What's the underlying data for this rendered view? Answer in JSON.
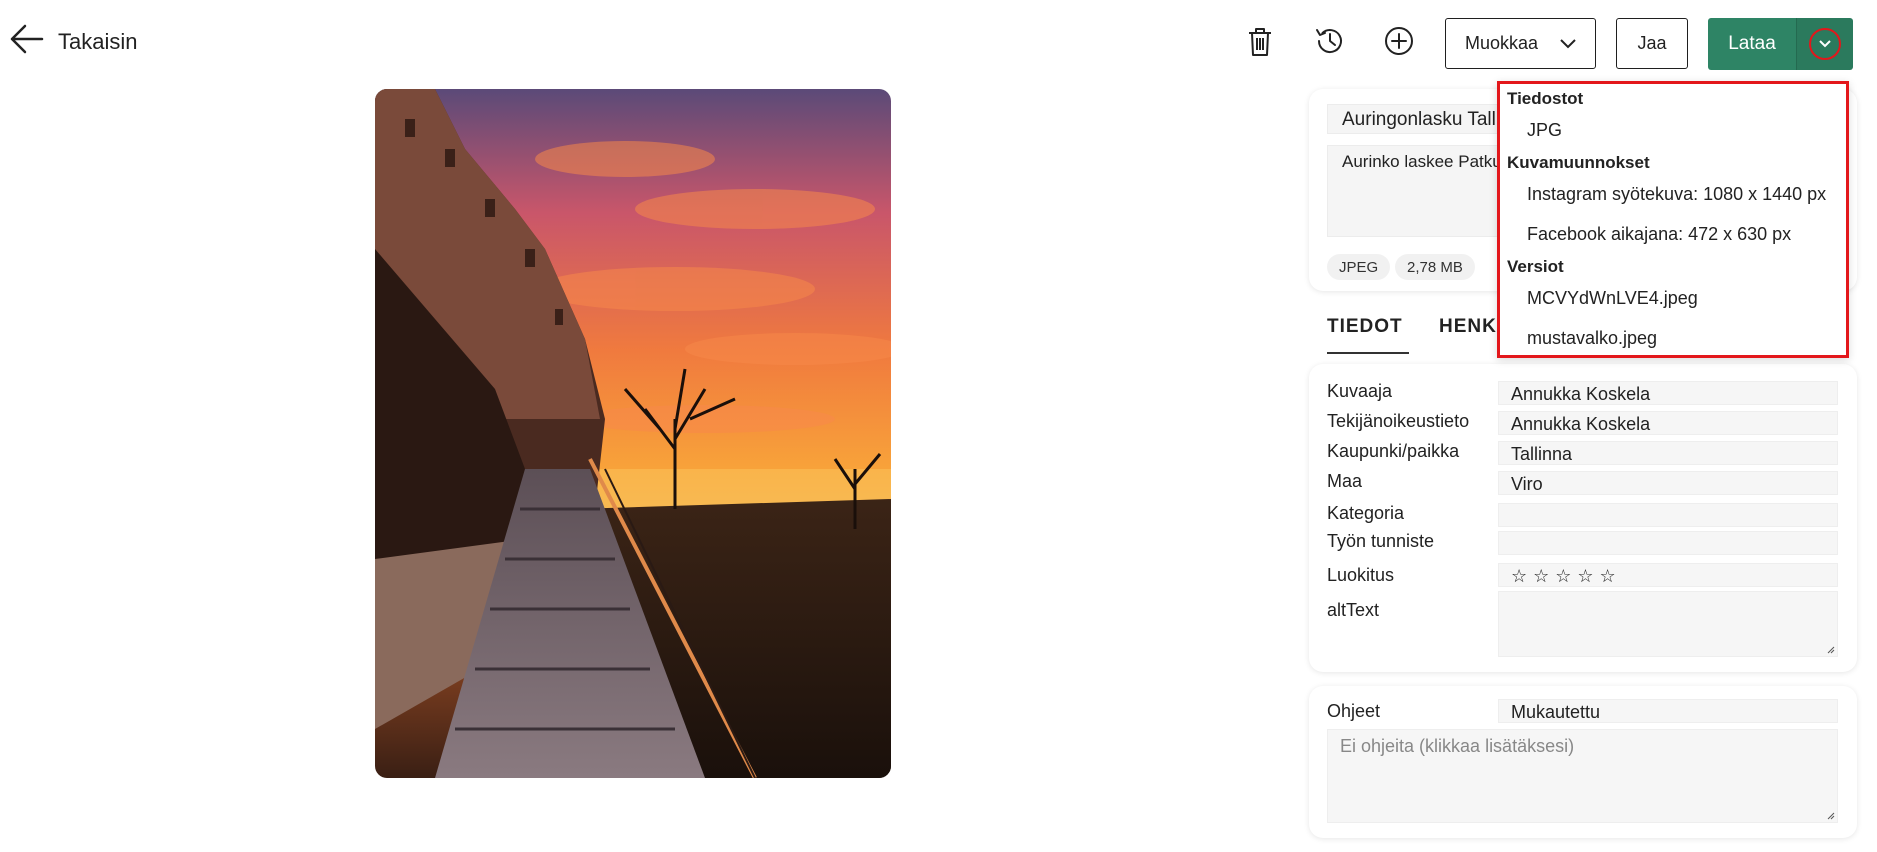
{
  "header": {
    "back_label": "Takaisin",
    "edit_label": "Muokkaa",
    "share_label": "Jaa",
    "download_label": "Lataa"
  },
  "asset": {
    "title": "Auringonlasku Tallinnassa",
    "description": "Aurinko laskee Patkuli",
    "chips": [
      "JPEG",
      "2,78 MB"
    ]
  },
  "tabs": [
    {
      "label": "TIEDOT"
    },
    {
      "label": "HENKILÖT"
    }
  ],
  "fields": [
    {
      "label": "Kuvaaja",
      "value": "Annukka Koskela"
    },
    {
      "label": "Tekijänoikeustieto",
      "value": "Annukka Koskela"
    },
    {
      "label": "Kaupunki/paikka",
      "value": "Tallinna"
    },
    {
      "label": "Maa",
      "value": "Viro"
    },
    {
      "label": "Kategoria",
      "value": ""
    },
    {
      "label": "Työn tunniste",
      "value": ""
    },
    {
      "label": "Luokitus",
      "value": "☆☆☆☆☆"
    },
    {
      "label": "altText",
      "value": ""
    }
  ],
  "rating": {
    "stars": 0,
    "max": 5
  },
  "instructions": {
    "label": "Ohjeet",
    "value": "Mukautettu",
    "placeholder": "Ei ohjeita (klikkaa lisätäksesi)"
  },
  "download_menu": {
    "files_heading": "Tiedostot",
    "files": [
      "JPG"
    ],
    "variants_heading": "Kuvamuunnokset",
    "variants": [
      "Instagram syötekuva: 1080 x 1440 px",
      "Facebook aikajana: 472 x 630 px"
    ],
    "versions_heading": "Versiot",
    "versions": [
      "MCVYdWnLVE4.jpeg",
      "mustavalko.jpeg"
    ]
  },
  "colors": {
    "accent": "#2e8465",
    "highlight": "#e3171b"
  }
}
